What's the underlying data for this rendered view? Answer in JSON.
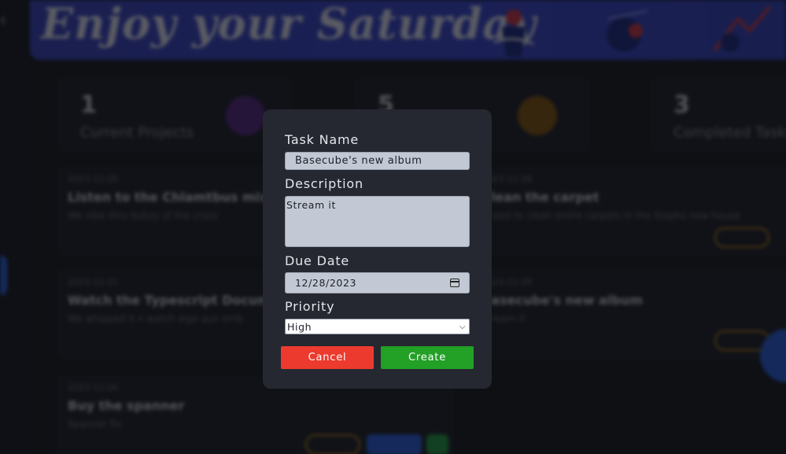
{
  "banner": {
    "title": "Enjoy your Saturday"
  },
  "sidebar": {
    "edge_text": "s"
  },
  "stats": [
    {
      "number": "1",
      "label": "Current Projects",
      "icon": "folder-icon"
    },
    {
      "number": "5",
      "label": "",
      "icon": "message-icon"
    },
    {
      "number": "3",
      "label": "Completed Tasks",
      "icon": "check-icon"
    }
  ],
  "tasks": [
    {
      "date": "2023-12-20",
      "title": "Listen to the Chlamtbus mixtape",
      "desc": "We vibe thru bubzy of the crazy"
    },
    {
      "date": "2023-12-28",
      "title": "Clean the carpet",
      "desc": "I need to clean entire carpets in the Stephs new house"
    },
    {
      "date": "2023-12-21",
      "title": "Watch the Typescript Documentary",
      "desc": "We whipped it n watch aige aun emb"
    },
    {
      "date": "2023-12-28",
      "title": "Basecube's new album",
      "desc": "Stream it"
    },
    {
      "date": "2023-12-26",
      "title": "Buy the spanner",
      "desc": "Spanner fix"
    }
  ],
  "modal": {
    "name_label": "Task Name",
    "name_value": "Basecube's new album",
    "desc_label": "Description",
    "desc_value": "Stream it",
    "date_label": "Due Date",
    "date_value": "12/28/2023",
    "priority_label": "Priority",
    "priority_value": "High",
    "cancel_label": "Cancel",
    "create_label": "Create"
  },
  "colors": {
    "cancel": "#ec3b2e",
    "create": "#23a026",
    "accent": "#2c63e8",
    "modal_bg": "#252830"
  }
}
